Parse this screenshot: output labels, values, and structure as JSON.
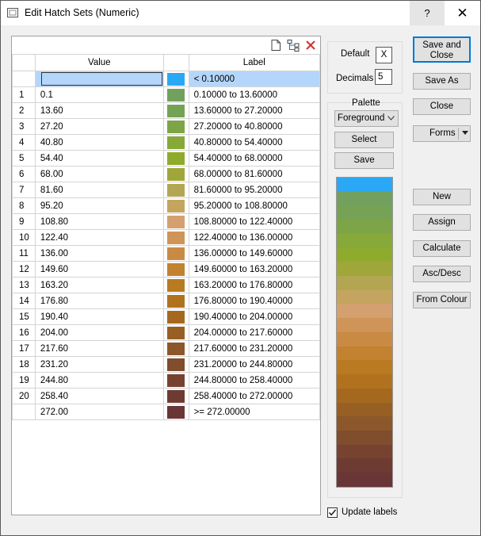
{
  "window": {
    "title": "Edit Hatch Sets (Numeric)",
    "help_label": "?",
    "close_label": "✕"
  },
  "grid": {
    "columns": {
      "value": "Value",
      "label": "Label"
    },
    "rows": [
      {
        "num": "",
        "value": "",
        "color": "#2aa8f5",
        "label": "< 0.10000",
        "selected": true
      },
      {
        "num": "1",
        "value": "0.1",
        "color": "#72a05e",
        "label": "0.10000 to 13.60000"
      },
      {
        "num": "2",
        "value": "13.60",
        "color": "#75a254",
        "label": "13.60000 to 27.20000"
      },
      {
        "num": "3",
        "value": "27.20",
        "color": "#7da547",
        "label": "27.20000 to 40.80000"
      },
      {
        "num": "4",
        "value": "40.80",
        "color": "#86a93a",
        "label": "40.80000 to 54.40000"
      },
      {
        "num": "5",
        "value": "54.40",
        "color": "#8fab2d",
        "label": "54.40000 to 68.00000"
      },
      {
        "num": "6",
        "value": "68.00",
        "color": "#a0a73a",
        "label": "68.00000 to 81.60000"
      },
      {
        "num": "7",
        "value": "81.60",
        "color": "#b3a652",
        "label": "81.60000 to 95.20000"
      },
      {
        "num": "8",
        "value": "95.20",
        "color": "#c4a560",
        "label": "95.20000 to 108.80000"
      },
      {
        "num": "9",
        "value": "108.80",
        "color": "#d4a070",
        "label": "108.80000 to 122.40000"
      },
      {
        "num": "10",
        "value": "122.40",
        "color": "#cf9458",
        "label": "122.40000 to 136.00000"
      },
      {
        "num": "11",
        "value": "136.00",
        "color": "#c98b44",
        "label": "136.00000 to 149.60000"
      },
      {
        "num": "12",
        "value": "149.60",
        "color": "#c2822f",
        "label": "149.60000 to 163.20000"
      },
      {
        "num": "13",
        "value": "163.20",
        "color": "#b97a22",
        "label": "163.20000 to 176.80000"
      },
      {
        "num": "14",
        "value": "176.80",
        "color": "#b0721f",
        "label": "176.80000 to 190.40000"
      },
      {
        "num": "15",
        "value": "190.40",
        "color": "#a4691f",
        "label": "190.40000 to 204.00000"
      },
      {
        "num": "16",
        "value": "204.00",
        "color": "#985f25",
        "label": "204.00000 to 217.60000"
      },
      {
        "num": "17",
        "value": "217.60",
        "color": "#8c572b",
        "label": "217.60000 to 231.20000"
      },
      {
        "num": "18",
        "value": "231.20",
        "color": "#804d2d",
        "label": "231.20000 to 244.80000"
      },
      {
        "num": "19",
        "value": "244.80",
        "color": "#774330",
        "label": "244.80000 to 258.40000"
      },
      {
        "num": "20",
        "value": "258.40",
        "color": "#6e3b33",
        "label": "258.40000 to 272.00000"
      },
      {
        "num": "",
        "value": "272.00",
        "color": "#6a3536",
        "label": ">= 272.00000"
      }
    ]
  },
  "settings": {
    "default_label": "Default",
    "default_value": "X",
    "decimals_label": "Decimals",
    "decimals_value": "5"
  },
  "palette": {
    "group_label": "Palette",
    "dropdown_value": "Foreground",
    "select_label": "Select",
    "save_label": "Save"
  },
  "buttons": {
    "save_close": "Save and Close",
    "save_as": "Save As",
    "close": "Close",
    "forms": "Forms",
    "new": "New",
    "assign": "Assign",
    "calculate": "Calculate",
    "ascdesc": "Asc/Desc",
    "from_colour": "From Colour"
  },
  "update_labels": {
    "label": "Update labels",
    "checked": true
  }
}
